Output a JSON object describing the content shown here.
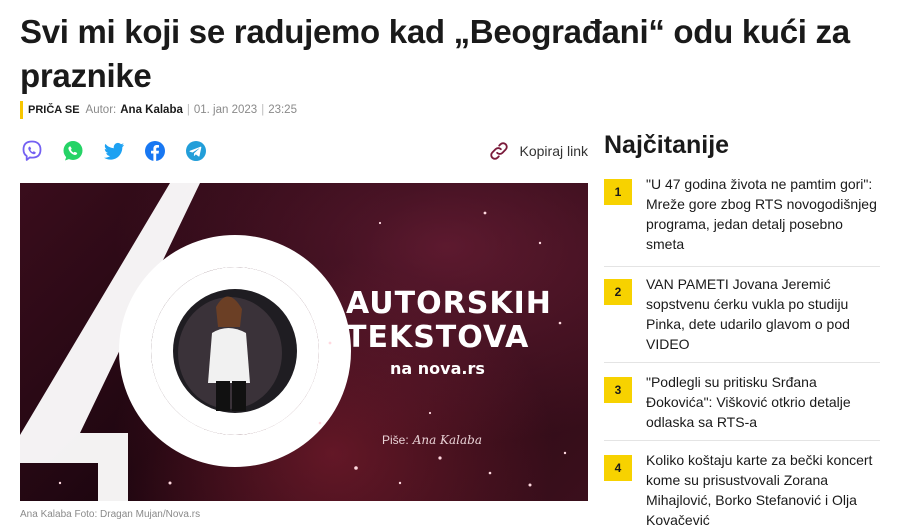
{
  "article": {
    "title": "Svi mi koji se radujemo kad „Beograđani“ odu kući za praznike",
    "category": "PRIČA SE",
    "author_label": "Autor:",
    "author": "Ana Kalaba",
    "date": "01. jan 2023",
    "time": "23:25",
    "separator": "|"
  },
  "share": {
    "icons": [
      "viber-icon",
      "whatsapp-icon",
      "twitter-icon",
      "facebook-icon",
      "telegram-icon"
    ],
    "copy_link_label": "Kopiraj link"
  },
  "hero": {
    "number": "40",
    "line1": "AUTORSKIH",
    "line2": "TEKSTOVA",
    "site": "na nova.rs",
    "signature_label": "Piše:",
    "signature_name": "Ana Kalaba",
    "caption": "Ana Kalaba Foto: Dragan Mujan/Nova.rs"
  },
  "sidebar": {
    "title": "Najčitanije",
    "items": [
      {
        "num": "1",
        "text": "\"U 47 godina života ne pamtim gori\": Mreže gore zbog RTS novogodišnjeg programa, jedan detalj posebno smeta"
      },
      {
        "num": "2",
        "text": "VAN PAMETI Jovana Jeremić sopstvenu ćerku vukla po studiju Pinka, dete udarilo glavom o pod VIDEO"
      },
      {
        "num": "3",
        "text": "\"Podlegli su pritisku Srđana Đokovića\": Višković otkrio detalje odlaska sa RTS-a"
      },
      {
        "num": "4",
        "text": "Koliko koštaju karte za bečki koncert kome su prisustvovali Zorana Mihajlović, Borko Stefanović i Olja Kovačević"
      }
    ]
  },
  "colors": {
    "accent": "#f7d200",
    "viber": "#7360f2",
    "whatsapp": "#25d366",
    "twitter": "#1da1f2",
    "facebook": "#1877f2",
    "telegram": "#229ed9"
  }
}
